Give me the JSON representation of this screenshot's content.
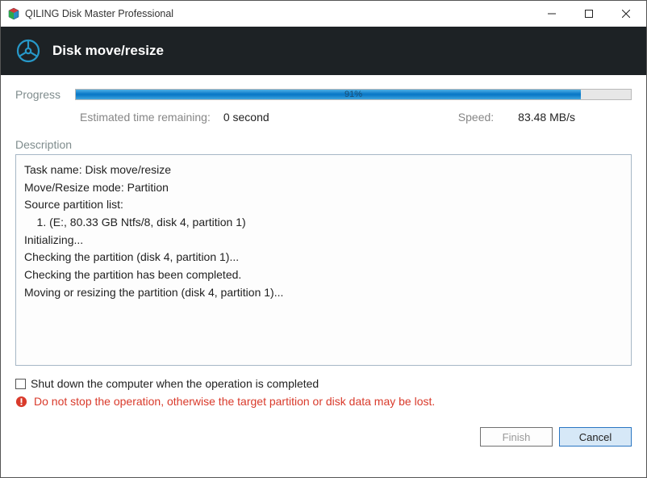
{
  "window": {
    "title": "QILING Disk Master Professional"
  },
  "header": {
    "title": "Disk move/resize"
  },
  "progress": {
    "label": "Progress",
    "percent": 91,
    "percent_text": "91%",
    "eta_label": "Estimated time remaining:",
    "eta_value": "0 second",
    "speed_label": "Speed:",
    "speed_value": "83.48 MB/s"
  },
  "description": {
    "label": "Description",
    "lines": [
      "Task name: Disk move/resize",
      "Move/Resize mode: Partition",
      "Source partition list:",
      "    1. (E:, 80.33 GB Ntfs/8, disk 4, partition 1)",
      "",
      "Initializing...",
      "Checking the partition (disk 4, partition 1)...",
      "Checking the partition has been completed.",
      "Moving or resizing the partition (disk 4, partition 1)..."
    ]
  },
  "options": {
    "shutdown_label": "Shut down the computer when the operation is completed",
    "shutdown_checked": false
  },
  "warning": {
    "text": "Do not stop the operation, otherwise the target partition or disk data may be lost."
  },
  "buttons": {
    "finish": "Finish",
    "cancel": "Cancel"
  }
}
